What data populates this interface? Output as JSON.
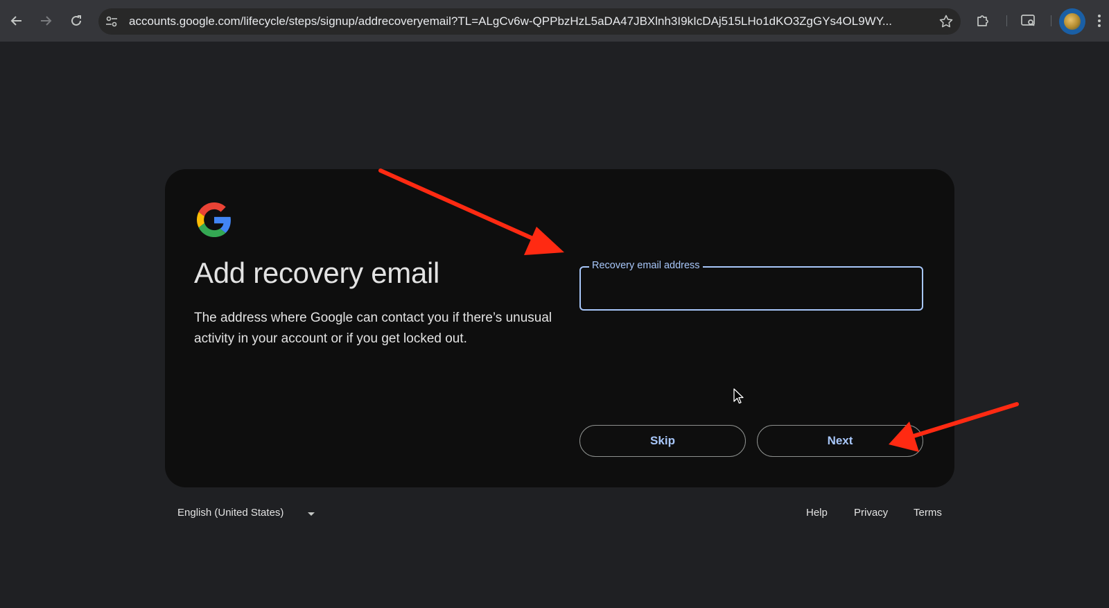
{
  "browser": {
    "url": "accounts.google.com/lifecycle/steps/signup/addrecoveryemail?TL=ALgCv6w-QPPbzHzL5aDA47JBXlnh3I9kIcDAj515LHo1dKO3ZgGYs4OL9WY...",
    "icons": [
      "back-arrow-icon",
      "forward-arrow-icon",
      "reload-icon",
      "site-settings-icon",
      "bookmark-star-icon",
      "extensions-puzzle-icon",
      "tab-search-icon",
      "profile-avatar",
      "more-vert-icon"
    ]
  },
  "card": {
    "logo": "google-g-logo",
    "title": "Add recovery email",
    "description": "The address where Google can contact you if there’s unusual activity in your account or if you get locked out.",
    "field": {
      "label": "Recovery email address",
      "value": ""
    },
    "skip_label": "Skip",
    "next_label": "Next"
  },
  "footer": {
    "language": "English (United States)",
    "help": "Help",
    "privacy": "Privacy",
    "terms": "Terms"
  },
  "colors": {
    "page_bg": "#1f2023",
    "card_bg": "#0e0e0e",
    "accent": "#a8c7fa",
    "annotation_arrow": "#ff2a12"
  }
}
